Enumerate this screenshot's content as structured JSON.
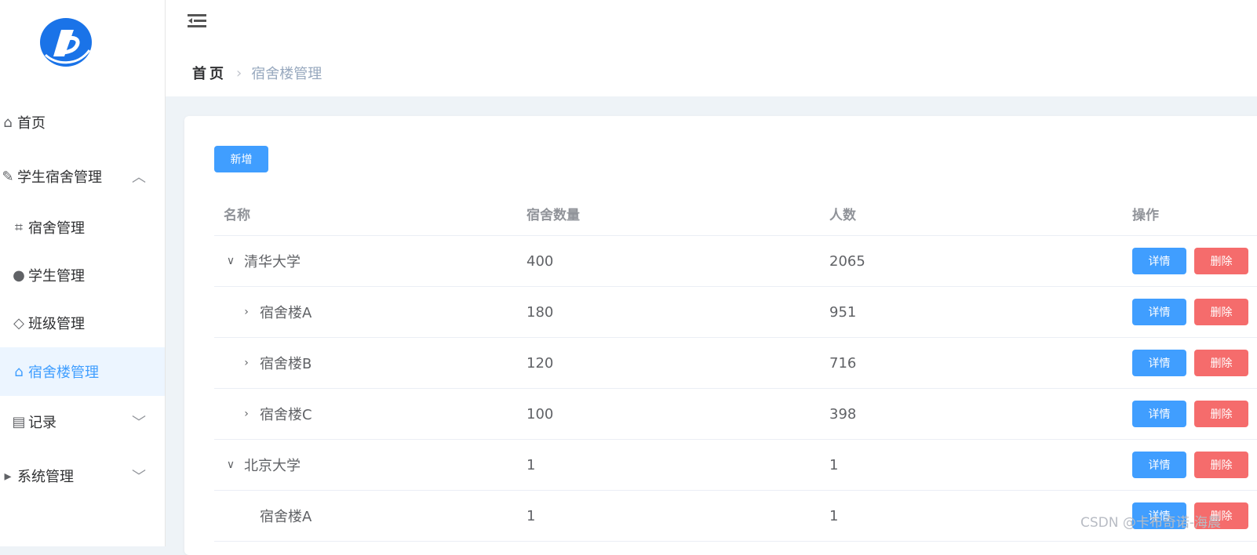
{
  "sidebar": {
    "items": [
      {
        "label": "首页",
        "icon": "house-icon"
      },
      {
        "label": "学生宿舍管理",
        "icon": "wrench-icon"
      },
      {
        "label": "宿舍管理",
        "icon": "crop-icon"
      },
      {
        "label": "学生管理",
        "icon": "user-icon"
      },
      {
        "label": "班级管理",
        "icon": "layers-icon"
      },
      {
        "label": "宿舍楼管理",
        "icon": "home-filled-icon"
      },
      {
        "label": "记录",
        "icon": "calendar-icon"
      },
      {
        "label": "系统管理",
        "icon": "triangle-icon"
      }
    ]
  },
  "header": {
    "breadcrumb": {
      "home": "首页",
      "current": "宿舍楼管理"
    }
  },
  "main": {
    "add_label": "新增",
    "table": {
      "headers": [
        "名称",
        "宿舍数量",
        "人数",
        "操作"
      ],
      "rows": [
        {
          "name": "清华大学",
          "count": "400",
          "people": "2065",
          "expander": "open"
        },
        {
          "name": "宿舍楼A",
          "count": "180",
          "people": "951",
          "expander": "closed"
        },
        {
          "name": "宿舍楼B",
          "count": "120",
          "people": "716",
          "expander": "closed"
        },
        {
          "name": "宿舍楼C",
          "count": "100",
          "people": "398",
          "expander": "closed"
        },
        {
          "name": "北京大学",
          "count": "1",
          "people": "1",
          "expander": "open"
        },
        {
          "name": "宿舍楼A",
          "count": "1",
          "people": "1",
          "expander": "none"
        }
      ],
      "detail_label": "详情",
      "delete_label": "删除"
    }
  },
  "watermark": "CSDN @卡布奇诺-海晨",
  "colors": {
    "primary": "#409eff",
    "danger": "#f56c6c",
    "active_bg": "#ecf5ff"
  }
}
